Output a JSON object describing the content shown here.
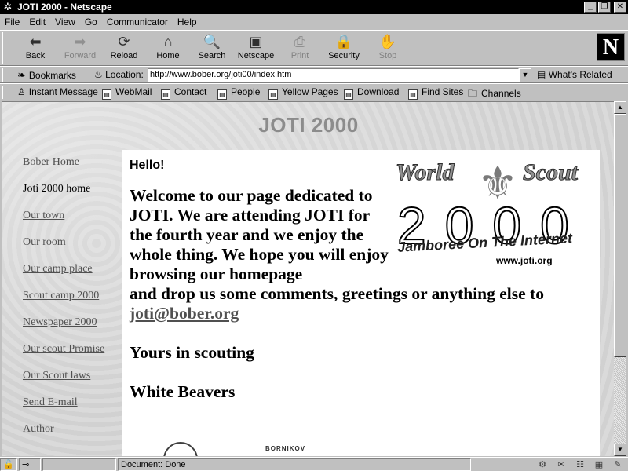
{
  "window": {
    "title": "JOTI 2000 - Netscape"
  },
  "menu": [
    "File",
    "Edit",
    "View",
    "Go",
    "Communicator",
    "Help"
  ],
  "nav_toolbar": [
    {
      "label": "Back",
      "icon": "back-arrow-icon",
      "glyph": "⬅",
      "enabled": true
    },
    {
      "label": "Forward",
      "icon": "forward-arrow-icon",
      "glyph": "➡",
      "enabled": false
    },
    {
      "label": "Reload",
      "icon": "reload-icon",
      "glyph": "⟳",
      "enabled": true
    },
    {
      "label": "Home",
      "icon": "home-icon",
      "glyph": "⌂",
      "enabled": true
    },
    {
      "label": "Search",
      "icon": "search-icon",
      "glyph": "🔍",
      "enabled": true
    },
    {
      "label": "Netscape",
      "icon": "netscape-icon",
      "glyph": "▣",
      "enabled": true
    },
    {
      "label": "Print",
      "icon": "print-icon",
      "glyph": "⎙",
      "enabled": false
    },
    {
      "label": "Security",
      "icon": "lock-icon",
      "glyph": "🔒",
      "enabled": true
    },
    {
      "label": "Stop",
      "icon": "stop-icon",
      "glyph": "✋",
      "enabled": false
    }
  ],
  "location_bar": {
    "bookmarks_label": "Bookmarks",
    "location_label": "Location:",
    "url": "http://www.bober.org/joti00/index.htm",
    "related_label": "What's Related"
  },
  "personal_toolbar": [
    "Instant Message",
    "WebMail",
    "Contact",
    "People",
    "Yellow Pages",
    "Download",
    "Find Sites",
    "Channels"
  ],
  "page": {
    "heading": "JOTI 2000",
    "nav": [
      {
        "label": "Bober Home",
        "link": true
      },
      {
        "label": "Joti 2000 home",
        "link": false
      },
      {
        "label": "Our town",
        "link": true
      },
      {
        "label": "Our room",
        "link": true
      },
      {
        "label": "Our camp place",
        "link": true
      },
      {
        "label": "Scout camp 2000",
        "link": true
      },
      {
        "label": "Newspaper 2000",
        "link": true
      },
      {
        "label": "Our scout Promise",
        "link": true
      },
      {
        "label": "Our Scout laws",
        "link": true
      },
      {
        "label": "Send E-mail",
        "link": true
      },
      {
        "label": "Author",
        "link": true
      }
    ],
    "hello": "Hello!",
    "welcome_narrow": "Welcome to our page dedicated to JOTI. We are attending JOTI for the fourth year and we enjoy the whole thing. We hope you will enjoy browsing our homepage",
    "welcome_rest": "and drop us some comments, greetings or anything else to",
    "email": "joti@bober.org",
    "closing": "Yours in scouting",
    "signature": "White Beavers",
    "logo": {
      "word1": "World",
      "word2": "Scout",
      "year": "2000",
      "banner": "Jamboree On The Internet",
      "url": "www.joti.org"
    },
    "footer_image_text": "BORNIKOV"
  },
  "status": {
    "text": "Document: Done"
  }
}
